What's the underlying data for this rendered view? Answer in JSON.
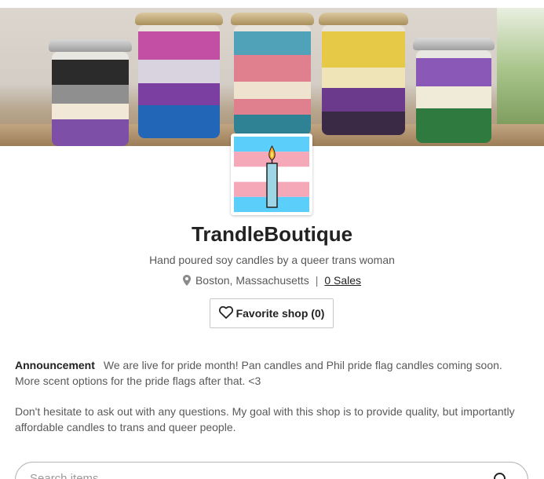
{
  "banner": {
    "alt": "Row of layered pride flag soy candles in jars"
  },
  "shop": {
    "name": "TrandleBoutique",
    "tagline": "Hand poured soy candles by a queer trans woman",
    "location": "Boston, Massachusetts",
    "sales_link": "0 Sales"
  },
  "actions": {
    "favorite_label": "Favorite shop (0)"
  },
  "announcement": {
    "label": "Announcement",
    "text": "We are live for pride month! Pan candles and Phil pride flag candles coming soon. More scent options for the pride flags after that. <3",
    "note": "Don't hesitate to ask out with any questions. My goal with this shop is to provide quality, but importantly affordable candles to trans and queer people."
  },
  "search": {
    "placeholder": "Search items"
  },
  "icons": {
    "location": "location-pin-icon",
    "favorite": "heart-icon",
    "search": "search-icon"
  },
  "colors": {
    "trans_blue": "#5bcefa",
    "trans_pink": "#f5a9b8",
    "text_primary": "#222222",
    "text_secondary": "#595959"
  }
}
